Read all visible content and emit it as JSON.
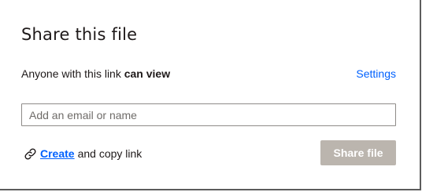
{
  "dialog": {
    "title": "Share this file"
  },
  "access": {
    "prefix": "Anyone with this link",
    "level": "can view",
    "settings_label": "Settings"
  },
  "email_input": {
    "placeholder": "Add an email or name",
    "value": ""
  },
  "create_link": {
    "icon": "link-icon",
    "link_label": "Create",
    "suffix": "and copy link"
  },
  "share_button": {
    "label": "Share file",
    "state": "disabled"
  },
  "colors": {
    "link": "#0061fe",
    "text": "#1e1919",
    "disabled_button": "#bbb5ae",
    "input_border": "#8e8b88"
  }
}
